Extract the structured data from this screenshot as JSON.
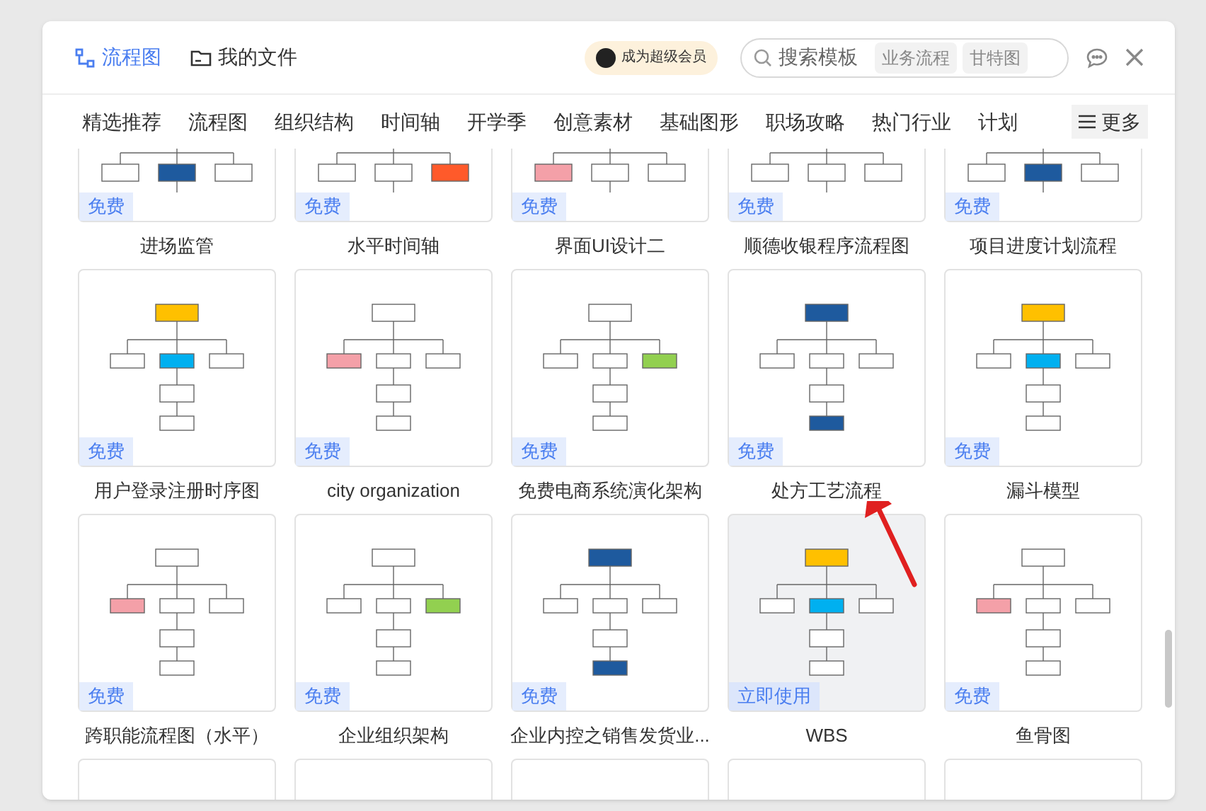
{
  "header": {
    "tabs": [
      {
        "label": "流程图",
        "selected": true
      },
      {
        "label": "我的文件",
        "selected": false
      }
    ],
    "vip_badge": "成为超级会员",
    "search": {
      "placeholder": "搜索模板",
      "chips": [
        "业务流程",
        "甘特图"
      ]
    }
  },
  "categories": [
    "精选推荐",
    "流程图",
    "组织结构",
    "时间轴",
    "开学季",
    "创意素材",
    "基础图形",
    "职场攻略",
    "热门行业",
    "计划"
  ],
  "more_button": "更多",
  "templates": [
    {
      "label": "进场监管",
      "badge": "免费",
      "hovered": false
    },
    {
      "label": "水平时间轴",
      "badge": "免费",
      "hovered": false
    },
    {
      "label": "界面UI设计二",
      "badge": "免费",
      "hovered": false
    },
    {
      "label": "顺德收银程序流程图",
      "badge": "免费",
      "hovered": false
    },
    {
      "label": "项目进度计划流程",
      "badge": "免费",
      "hovered": false
    },
    {
      "label": "用户登录注册时序图",
      "badge": "免费",
      "hovered": false
    },
    {
      "label": "city organization",
      "badge": "免费",
      "hovered": false
    },
    {
      "label": "免费电商系统演化架构",
      "badge": "免费",
      "hovered": false
    },
    {
      "label": "处方工艺流程",
      "badge": "免费",
      "hovered": false
    },
    {
      "label": "漏斗模型",
      "badge": "免费",
      "hovered": false
    },
    {
      "label": "跨职能流程图（水平）",
      "badge": "免费",
      "hovered": false
    },
    {
      "label": "企业组织架构",
      "badge": "免费",
      "hovered": false
    },
    {
      "label": "企业内控之销售发货业...",
      "badge": "免费",
      "hovered": false
    },
    {
      "label": "WBS",
      "badge": "立即使用",
      "hovered": true
    },
    {
      "label": "鱼骨图",
      "badge": "免费",
      "hovered": false
    }
  ]
}
